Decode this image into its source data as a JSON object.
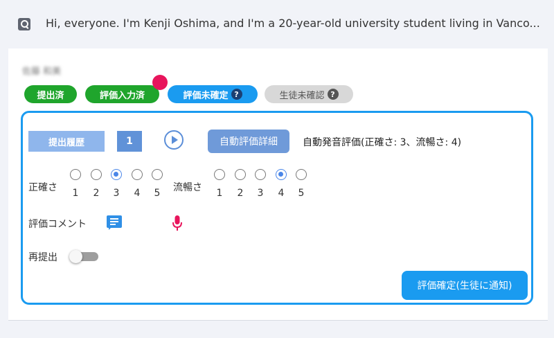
{
  "header": {
    "search_icon": "search-icon",
    "text": "Hi, everyone. I'm Kenji Oshima, and I'm a 20-year-old university student living in Vanco..."
  },
  "student": {
    "name": "佐藤 和美"
  },
  "status_badges": [
    {
      "label": "提出済",
      "color": "#1fa52c"
    },
    {
      "label": "評価入力済",
      "color": "#1fa52c"
    },
    {
      "label": "評価未確定",
      "color": "#1a9bf0",
      "help": "?"
    },
    {
      "label": "生徒未確認",
      "color": "#d8d8d8",
      "help": "?"
    }
  ],
  "evaluation": {
    "history_button": "提出履歴",
    "history_number": "1",
    "auto_detail_button": "自動評価詳細",
    "auto_eval_text": "自動発音評価(正確さ: 3、流暢さ: 4)",
    "accuracy": {
      "label": "正確さ",
      "options": [
        "1",
        "2",
        "3",
        "4",
        "5"
      ],
      "selected": "3"
    },
    "fluency": {
      "label": "流暢さ",
      "options": [
        "1",
        "2",
        "3",
        "4",
        "5"
      ],
      "selected": "4"
    },
    "comment_label": "評価コメント",
    "resubmit_label": "再提出",
    "resubmit_enabled": false,
    "confirm_button": "評価確定(生徒に通知)"
  },
  "colors": {
    "accent_blue": "#1a9bf0",
    "green": "#1fa52c",
    "notification_red": "#e8155c",
    "mic_pink": "#e8155c"
  }
}
